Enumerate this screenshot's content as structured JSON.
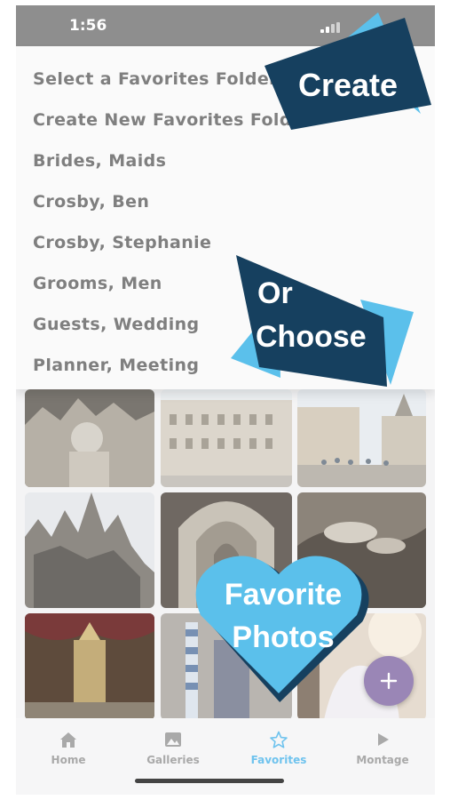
{
  "status_bar": {
    "time": "1:56"
  },
  "menu": {
    "items": [
      "Select a Favorites Folder",
      "Create New Favorites Folder",
      "Brides, Maids",
      "Crosby, Ben",
      "Crosby, Stephanie",
      "Grooms, Men",
      "Guests, Wedding",
      "Planner, Meeting"
    ]
  },
  "overlays": {
    "create": "Create",
    "or": "Or",
    "choose": "Choose",
    "favorite_line1": "Favorite",
    "favorite_line2": "Photos"
  },
  "tabs": [
    {
      "label": "Home",
      "icon": "home-icon"
    },
    {
      "label": "Galleries",
      "icon": "image-icon"
    },
    {
      "label": "Favorites",
      "icon": "star-icon",
      "active": true
    },
    {
      "label": "Montage",
      "icon": "play-icon"
    }
  ],
  "fab": {
    "symbol": "+"
  },
  "colors": {
    "accent": "#6fc3ee",
    "navy": "#16405f",
    "sky": "#5bc0eb",
    "fab": "#9a86b6"
  }
}
